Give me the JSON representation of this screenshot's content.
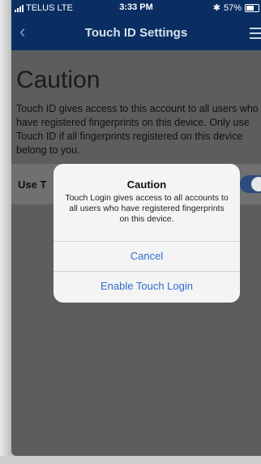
{
  "status_bar": {
    "carrier": "TELUS",
    "network": "LTE",
    "time": "3:33 PM",
    "bluetooth": "✱",
    "battery": "57%"
  },
  "nav": {
    "title": "Touch ID Settings",
    "back_icon": "chevron-left-icon",
    "menu_icon": "hamburger-menu-icon"
  },
  "content": {
    "heading": "Caution",
    "body": "Touch ID gives access to this account to all users who have registered fingerprints on this device. Only use Touch ID if all fingerprints registered on this device belong to you.",
    "toggle_label": "Use T"
  },
  "alert": {
    "title": "Caution",
    "message": "Touch Login gives access to all accounts to all users who have registered fingerprints on this device.",
    "cancel": "Cancel",
    "enable": "Enable Touch Login"
  },
  "colors": {
    "nav_bg": "#0a2e62",
    "alert_button": "#2f6fd0",
    "toggle_on": "#2e4b7d"
  }
}
